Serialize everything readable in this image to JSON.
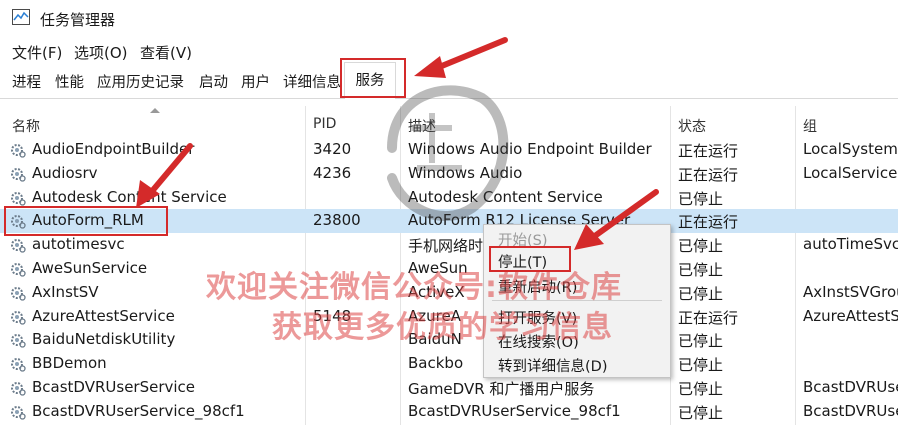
{
  "window": {
    "title": "任务管理器"
  },
  "menu": [
    "文件(F)",
    "选项(O)",
    "查看(V)"
  ],
  "tabs": [
    "进程",
    "性能",
    "应用历史记录",
    "启动",
    "用户",
    "详细信息",
    "服务"
  ],
  "active_tab": "服务",
  "columns": {
    "name": "名称",
    "pid": "PID",
    "desc": "描述",
    "status": "状态",
    "group": "组"
  },
  "rows": [
    {
      "name": "AudioEndpointBuilder",
      "pid": "3420",
      "desc": "Windows Audio Endpoint Builder",
      "status": "正在运行",
      "group": "LocalSystem..."
    },
    {
      "name": "Audiosrv",
      "pid": "4236",
      "desc": "Windows Audio",
      "status": "正在运行",
      "group": "LocalService..."
    },
    {
      "name": "Autodesk Content Service",
      "pid": "",
      "desc": "Autodesk Content Service",
      "status": "已停止",
      "group": ""
    },
    {
      "name": "AutoForm_RLM",
      "pid": "23800",
      "desc": "AutoForm R12 License Server",
      "status": "正在运行",
      "group": ""
    },
    {
      "name": "autotimesvc",
      "pid": "",
      "desc": "手机网络时间",
      "status": "已停止",
      "group": "autoTimeSvc"
    },
    {
      "name": "AweSunService",
      "pid": "",
      "desc": "AweSun",
      "status": "已停止",
      "group": ""
    },
    {
      "name": "AxInstSV",
      "pid": "",
      "desc": "ActiveX",
      "status": "已停止",
      "group": "AxInstSVGroup"
    },
    {
      "name": "AzureAttestService",
      "pid": "5148",
      "desc": "AzureA",
      "status": "正在运行",
      "group": "AzureAttestS"
    },
    {
      "name": "BaiduNetdiskUtility",
      "pid": "",
      "desc": "BaiduN",
      "status": "已停止",
      "group": ""
    },
    {
      "name": "BBDemon",
      "pid": "",
      "desc": "Backbo",
      "status": "已停止",
      "group": ""
    },
    {
      "name": "BcastDVRUserService",
      "pid": "",
      "desc": "GameDVR 和广播用户服务",
      "status": "已停止",
      "group": "BcastDVRUse"
    },
    {
      "name": "BcastDVRUserService_98cf1",
      "pid": "",
      "desc": "BcastDVRUserService_98cf1",
      "status": "已停止",
      "group": "BcastDVRUse"
    }
  ],
  "context_menu": {
    "start": "开始(S)",
    "stop": "停止(T)",
    "restart": "重新启动(R)",
    "open_services": "打开服务(V)",
    "search_online": "在线搜索(O)",
    "goto_details": "转到详细信息(D)"
  },
  "watermark": {
    "line1": "欢迎关注微信公众号:软件仓库",
    "line2": "获取更多优质的学习信息"
  },
  "colors": {
    "selected_row": "#cce4f7",
    "annotation": "#d42a2a",
    "menu_bg": "#f2f2f2"
  }
}
